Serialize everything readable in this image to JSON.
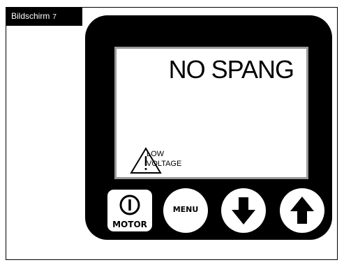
{
  "figure_tag": {
    "label": "Bildschirm",
    "number": "7"
  },
  "display": {
    "message": "NO SPANG",
    "warning": {
      "icon": "warning-triangle-icon",
      "line1": "LOW",
      "line2": "VOLTAGE"
    }
  },
  "buttons": {
    "motor": {
      "label": "MOTOR",
      "icon": "power-icon"
    },
    "menu": {
      "label": "MENU"
    },
    "down": {
      "icon": "arrow-down-icon"
    },
    "up": {
      "icon": "arrow-up-icon"
    }
  }
}
